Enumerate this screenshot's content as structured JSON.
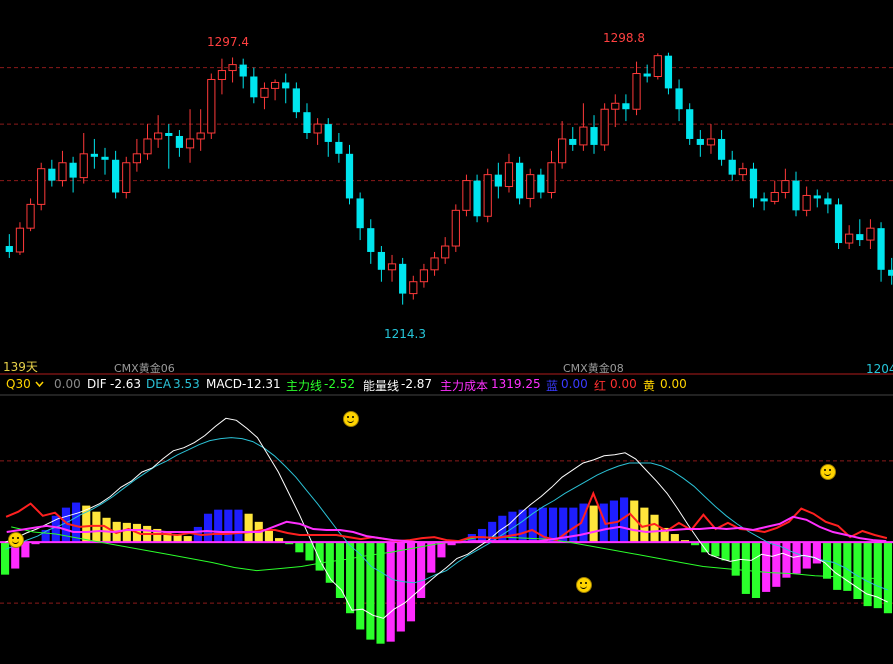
{
  "chart_data": {
    "type": "candlestick",
    "price_panel": {
      "candles": [
        [
          1234,
          1232,
          1238,
          1230
        ],
        [
          1232,
          1240,
          1242,
          1231
        ],
        [
          1240,
          1248,
          1250,
          1239
        ],
        [
          1248,
          1260,
          1262,
          1246
        ],
        [
          1260,
          1256,
          1263,
          1254
        ],
        [
          1256,
          1262,
          1266,
          1254
        ],
        [
          1262,
          1257,
          1264,
          1252
        ],
        [
          1257,
          1265,
          1272,
          1255
        ],
        [
          1265,
          1264,
          1270,
          1260
        ],
        [
          1264,
          1263,
          1267,
          1258
        ],
        [
          1263,
          1252,
          1266,
          1250
        ],
        [
          1252,
          1262,
          1264,
          1250
        ],
        [
          1262,
          1265,
          1270,
          1259
        ],
        [
          1265,
          1270,
          1275,
          1263
        ],
        [
          1270,
          1272,
          1278,
          1267
        ],
        [
          1272,
          1271,
          1275,
          1260
        ],
        [
          1271,
          1267,
          1273,
          1264
        ],
        [
          1267,
          1270,
          1280,
          1262
        ],
        [
          1270,
          1272,
          1280,
          1266
        ],
        [
          1272,
          1290,
          1292,
          1270
        ],
        [
          1290,
          1293,
          1297,
          1285
        ],
        [
          1293,
          1295,
          1297.4,
          1289
        ],
        [
          1295,
          1291,
          1297,
          1287
        ],
        [
          1291,
          1284,
          1294,
          1282
        ],
        [
          1284,
          1287,
          1289,
          1280
        ],
        [
          1287,
          1289,
          1290,
          1283
        ],
        [
          1289,
          1287,
          1292,
          1282
        ],
        [
          1287,
          1279,
          1289,
          1277
        ],
        [
          1279,
          1272,
          1282,
          1270
        ],
        [
          1272,
          1275,
          1277,
          1268
        ],
        [
          1275,
          1269,
          1277,
          1264
        ],
        [
          1269,
          1265,
          1272,
          1262
        ],
        [
          1265,
          1250,
          1268,
          1248
        ],
        [
          1250,
          1240,
          1252,
          1236
        ],
        [
          1240,
          1232,
          1243,
          1228
        ],
        [
          1232,
          1226,
          1234,
          1222
        ],
        [
          1226,
          1228,
          1231,
          1222
        ],
        [
          1228,
          1218,
          1230,
          1214.3
        ],
        [
          1218,
          1222,
          1224,
          1216
        ],
        [
          1222,
          1226,
          1228,
          1220
        ],
        [
          1226,
          1230,
          1232,
          1224
        ],
        [
          1230,
          1234,
          1237,
          1228
        ],
        [
          1234,
          1246,
          1248,
          1232
        ],
        [
          1246,
          1256,
          1258,
          1244
        ],
        [
          1256,
          1244,
          1258,
          1242
        ],
        [
          1244,
          1258,
          1260,
          1242
        ],
        [
          1258,
          1254,
          1262,
          1250
        ],
        [
          1254,
          1262,
          1265,
          1252
        ],
        [
          1262,
          1250,
          1264,
          1248
        ],
        [
          1250,
          1258,
          1260,
          1247
        ],
        [
          1258,
          1252,
          1260,
          1250
        ],
        [
          1252,
          1262,
          1266,
          1250
        ],
        [
          1262,
          1270,
          1276,
          1260
        ],
        [
          1270,
          1268,
          1274,
          1266
        ],
        [
          1268,
          1274,
          1282,
          1266
        ],
        [
          1274,
          1268,
          1278,
          1265
        ],
        [
          1268,
          1280,
          1282,
          1266
        ],
        [
          1280,
          1282,
          1285,
          1274
        ],
        [
          1282,
          1280,
          1285,
          1276
        ],
        [
          1280,
          1292,
          1296,
          1278
        ],
        [
          1292,
          1291,
          1295,
          1289
        ],
        [
          1291,
          1298,
          1298.8,
          1290
        ],
        [
          1298,
          1287,
          1299,
          1285
        ],
        [
          1287,
          1280,
          1290,
          1276
        ],
        [
          1280,
          1270,
          1282,
          1268
        ],
        [
          1270,
          1268,
          1273,
          1264
        ],
        [
          1268,
          1270,
          1275,
          1265
        ],
        [
          1270,
          1263,
          1273,
          1261
        ],
        [
          1263,
          1258,
          1266,
          1256
        ],
        [
          1258,
          1260,
          1262,
          1256
        ],
        [
          1260,
          1250,
          1262,
          1247
        ],
        [
          1250,
          1249,
          1252,
          1246
        ],
        [
          1249,
          1252,
          1256,
          1248
        ],
        [
          1252,
          1256,
          1260,
          1250
        ],
        [
          1256,
          1246,
          1259,
          1244
        ],
        [
          1246,
          1251,
          1254,
          1244
        ],
        [
          1251,
          1250,
          1253,
          1247
        ],
        [
          1250,
          1248,
          1252,
          1245
        ],
        [
          1248,
          1235,
          1250,
          1233
        ],
        [
          1235,
          1238,
          1241,
          1233
        ],
        [
          1238,
          1236,
          1243,
          1234
        ],
        [
          1236,
          1240,
          1243,
          1233
        ],
        [
          1240,
          1226,
          1242,
          1222
        ],
        [
          1226,
          1224,
          1230,
          1221
        ]
      ],
      "y_range": [
        1195,
        1310
      ],
      "grid_levels": [
        1294,
        1275,
        1256
      ],
      "labels": {
        "high1": "1297.4",
        "high2": "1298.8",
        "low1": "1214.3",
        "edge_value": "1204",
        "days": "139天",
        "contract1": "CMX黄金06",
        "contract2": "CMX黄金08"
      }
    },
    "indicator_panel": {
      "macd": [
        -3.2,
        -2.6,
        -1.5,
        -0.2,
        1.2,
        2.6,
        3.4,
        3.9,
        3.6,
        3.0,
        2.4,
        2.0,
        1.9,
        1.8,
        1.6,
        1.3,
        1.0,
        0.8,
        0.6,
        1.5,
        2.8,
        3.2,
        3.2,
        3.2,
        2.8,
        2.0,
        1.2,
        0.4,
        -0.2,
        -1.0,
        -1.8,
        -2.8,
        -4.0,
        -5.5,
        -7.0,
        -8.6,
        -9.6,
        -10.0,
        -9.8,
        -8.8,
        -7.8,
        -5.5,
        -3.0,
        -1.5,
        -0.3,
        0.2,
        0.8,
        1.3,
        2.0,
        2.6,
        3.0,
        3.2,
        3.4,
        3.4,
        3.4,
        3.4,
        3.4,
        3.8,
        3.6,
        3.8,
        4.1,
        4.4,
        4.1,
        3.4,
        2.7,
        1.4,
        0.8,
        0.2,
        -0.3,
        -1.0,
        -1.4,
        -1.8,
        -3.3,
        -5.1,
        -5.5,
        -4.9,
        -4.4,
        -3.5,
        -3.1,
        -2.6,
        -2.1,
        -3.6,
        -4.7,
        -4.8,
        -5.6,
        -6.3,
        -6.5,
        -7.0
      ],
      "dif": [
        0.0,
        0.4,
        0.9,
        1.3,
        1.8,
        2.3,
        2.6,
        2.9,
        3.3,
        3.8,
        4.5,
        5.4,
        6.0,
        6.9,
        7.3,
        8.2,
        9.0,
        9.3,
        9.8,
        10.5,
        11.4,
        12.2,
        12.0,
        11.2,
        10.3,
        8.6,
        6.9,
        4.8,
        2.7,
        0.4,
        -1.9,
        -3.7,
        -4.7,
        -6.7,
        -6.6,
        -7.2,
        -7.5,
        -6.6,
        -6.0,
        -5.1,
        -4.2,
        -3.3,
        -2.5,
        -1.6,
        -1.2,
        -0.5,
        0.2,
        1.1,
        1.8,
        2.8,
        3.7,
        4.5,
        5.4,
        6.4,
        7.1,
        7.8,
        8.1,
        8.5,
        8.6,
        8.8,
        8.2,
        7.1,
        6.0,
        4.8,
        3.3,
        1.7,
        0.2,
        -1.2,
        -1.6,
        -1.9,
        -1.7,
        -1.8,
        -1.2,
        -1.4,
        -1.1,
        -1.5,
        -1.3,
        -1.5,
        -2.0,
        -3.0,
        -3.7,
        -4.4,
        -5.1,
        -5.4,
        -5.9
      ],
      "dea": [
        -0.7,
        -0.3,
        0.2,
        0.6,
        1.2,
        1.6,
        2.1,
        2.7,
        3.2,
        3.8,
        4.5,
        5.3,
        6.1,
        6.8,
        7.5,
        8.0,
        8.6,
        9.1,
        9.6,
        10.0,
        10.2,
        10.3,
        10.2,
        9.9,
        9.3,
        8.5,
        7.5,
        6.4,
        5.1,
        3.8,
        2.4,
        1.0,
        -0.3,
        -1.2,
        -2.4,
        -3.0,
        -3.7,
        -3.9,
        -4.0,
        -3.7,
        -3.2,
        -2.8,
        -2.0,
        -1.3,
        -0.7,
        -0.1,
        0.6,
        1.3,
        2.0,
        2.8,
        3.5,
        4.1,
        4.8,
        5.4,
        6.0,
        6.6,
        7.1,
        7.5,
        7.8,
        7.8,
        7.8,
        7.5,
        7.0,
        6.3,
        5.5,
        4.5,
        3.5,
        2.6,
        1.8,
        1.1,
        0.5,
        -0.1,
        -0.4,
        -0.9,
        -1.3,
        -1.5,
        -1.8,
        -2.0,
        -2.5,
        -3.2,
        -3.8,
        -4.3,
        -4.7
      ],
      "red_line": [
        2.5,
        3.0,
        3.8,
        2.6,
        2.9,
        1.8,
        1.5,
        1.6,
        1.6,
        0.9,
        1.3,
        0.8,
        0.8,
        0.8,
        0.7,
        0.9,
        0.7,
        0.8,
        0.8,
        0.9,
        1.0,
        1.2,
        1.2,
        0.9,
        0.7,
        0.7,
        0.7,
        0.7,
        0.5,
        0.3,
        0.5,
        0.3,
        0.1,
        0.2,
        0.4,
        0.5,
        0.2,
        0.1,
        0.5,
        0.5,
        0.4,
        0.6,
        0.8,
        1.2,
        0.5,
        0.2,
        1.1,
        1.9,
        4.8,
        1.8,
        2.0,
        2.8,
        1.5,
        1.8,
        1.1,
        1.9,
        1.2,
        2.7,
        1.3,
        1.9,
        1.3,
        1.2,
        1.0,
        1.4,
        2.0,
        3.3,
        2.8,
        2.0,
        1.6,
        0.5,
        1.1,
        0.7,
        0.4
      ],
      "magenta_line": [
        1.0,
        1.2,
        1.4,
        1.6,
        1.4,
        1.0,
        1.0,
        1.1,
        1.0,
        1.2,
        1.2,
        1.1,
        1.0,
        1.0,
        1.0,
        1.1,
        1.0,
        1.0,
        1.0,
        1.0,
        1.5,
        2.0,
        1.8,
        1.3,
        1.2,
        1.2,
        1.0,
        0.6,
        0.4,
        0.2,
        0.1,
        0.0,
        0.0,
        0.0,
        0.0,
        0.1,
        0.1,
        0.1,
        0.1,
        0.1,
        0.1,
        0.3,
        0.5,
        0.7,
        1.0,
        1.3,
        1.5,
        1.2,
        1.0,
        1.1,
        1.2,
        1.3,
        1.3,
        1.4,
        1.3,
        1.4,
        1.2,
        1.5,
        1.8,
        2.5,
        2.2,
        1.5,
        1.0,
        0.7,
        0.4,
        0.2,
        0.1
      ],
      "green_line": [
        1.5,
        1.0,
        0.8,
        0.4,
        0.0,
        -0.4,
        -0.8,
        -1.2,
        -1.6,
        -2.0,
        -2.5,
        -2.8,
        -2.6,
        -2.4,
        -2.0,
        -1.7,
        -1.3,
        -1.0,
        -0.6,
        -0.2,
        0.1,
        0.5,
        0.5,
        0.4,
        0.3,
        0.0,
        -0.4,
        -0.8,
        -1.2,
        -1.6,
        -2.0,
        -2.4,
        -2.6,
        -2.8,
        -3.0,
        -3.1,
        -3.3,
        -3.4,
        -3.5,
        -3.6
      ],
      "y_range": [
        -12,
        14
      ],
      "signals": [
        {
          "bar": 1,
          "value": 0.3,
          "kind": "buy"
        },
        {
          "bar": 34,
          "value": 12.2,
          "kind": "sell"
        },
        {
          "bar": 57,
          "value": -4.1,
          "kind": "buy"
        },
        {
          "bar": 81,
          "value": 7.0,
          "kind": "sell"
        }
      ]
    }
  },
  "indicator_header": {
    "name": "Q30",
    "dropdown_icon": "chevron-down-icon",
    "zero": "0.00",
    "dif_label": "DIF",
    "dif_value": "-2.63",
    "dea_label": "DEA",
    "dea_value": "3.53",
    "macd_label": "MACD",
    "macd_value": "-12.31",
    "main_label": "主力线",
    "main_value": "-2.52",
    "energy_label": "能量线",
    "energy_value": "-2.87",
    "cost_label": "主力成本",
    "cost_value": "1319.25",
    "blue_label": "蓝",
    "blue_value": "0.00",
    "red_label": "红",
    "red_value": "0.00",
    "yellow_label": "黄",
    "yellow_value": "0.00"
  },
  "colors": {
    "background": "#000000",
    "up": "#ff3a3a",
    "down": "#00e5ee",
    "grid": "#8b1a1a",
    "bar_yellow": "#ffe63c",
    "bar_blue": "#1e1eff",
    "bar_green": "#2bff2b",
    "bar_magenta": "#ff2bff",
    "dif_line": "#ffffff",
    "dea_line": "#2bc2d6",
    "main_line": "#ff2020",
    "energy_line": "#ff30ff",
    "green_line": "#2bff2b"
  }
}
